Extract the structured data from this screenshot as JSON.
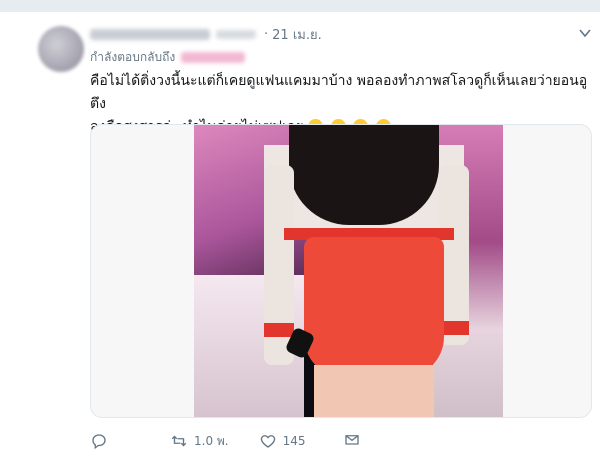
{
  "tweet": {
    "date": "21 เม.ย.",
    "dot": "·",
    "reply_label": "กำลังตอบกลับถึง",
    "text_line1": "คือไม่ได้ติ่งวงนี้นะแต่ก็เคยดูแฟนแคมมาบ้าง พอลองทำภาพสโลวดูก็เห็นเลยว่ายอนอูตึง",
    "text_line2": "ลงคือสงสารอ่ะ ทำไมค่ายไม่เซฟเลย",
    "emoji_name": "joy-emoji"
  },
  "actions": {
    "retweet_count": "1.0 พ.",
    "like_count": "145"
  },
  "colors": {
    "accent": "#1da1f2",
    "muted": "#657786",
    "border": "#e1e8ed"
  },
  "icons": [
    "reply-icon",
    "retweet-icon",
    "like-icon",
    "share-icon",
    "chevron-down-icon"
  ]
}
